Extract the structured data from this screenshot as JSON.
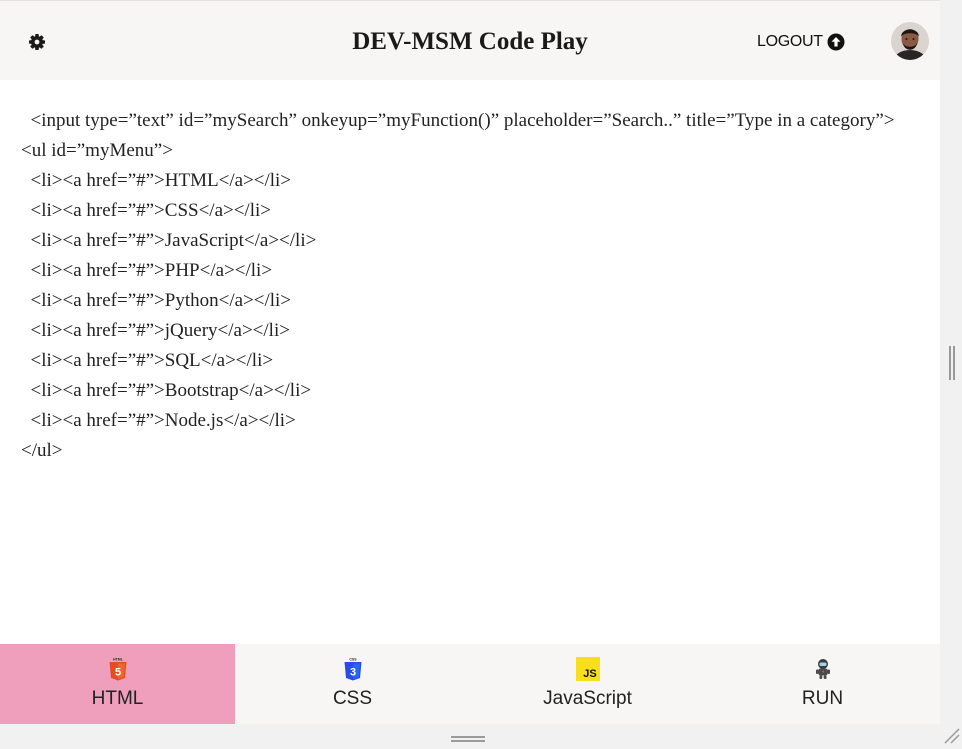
{
  "header": {
    "title": "DEV-MSM Code Play",
    "logout_label": "LOGOUT",
    "settings_icon": "gear-icon",
    "logout_icon": "arrow-up-circle-icon",
    "background": "#f8f6f4"
  },
  "editor": {
    "lines": [
      "  <input type=”text” id=”mySearch” onkeyup=”myFunction()” placeholder=”Search..” title=”Type in a category”>",
      "<ul id=”myMenu”>",
      "  <li><a href=”#”>HTML</a></li>",
      "  <li><a href=”#”>CSS</a></li>",
      "  <li><a href=”#”>JavaScript</a></li>",
      "  <li><a href=”#”>PHP</a></li>",
      "  <li><a href=”#”>Python</a></li>",
      "  <li><a href=”#”>jQuery</a></li>",
      "  <li><a href=”#”>SQL</a></li>",
      "  <li><a href=”#”>Bootstrap</a></li>",
      "  <li><a href=”#”>Node.js</a></li>",
      "</ul>"
    ]
  },
  "tabs": [
    {
      "label": "HTML",
      "icon": "html5-icon",
      "active": true
    },
    {
      "label": "CSS",
      "icon": "css3-icon",
      "active": false
    },
    {
      "label": "JavaScript",
      "icon": "javascript-icon",
      "active": false
    },
    {
      "label": "RUN",
      "icon": "astronaut-icon",
      "active": false
    }
  ],
  "colors": {
    "active_tab": "#ef9ebc",
    "html5": "#e44d26",
    "css3": "#264de4",
    "javascript": "#f7df1e"
  }
}
